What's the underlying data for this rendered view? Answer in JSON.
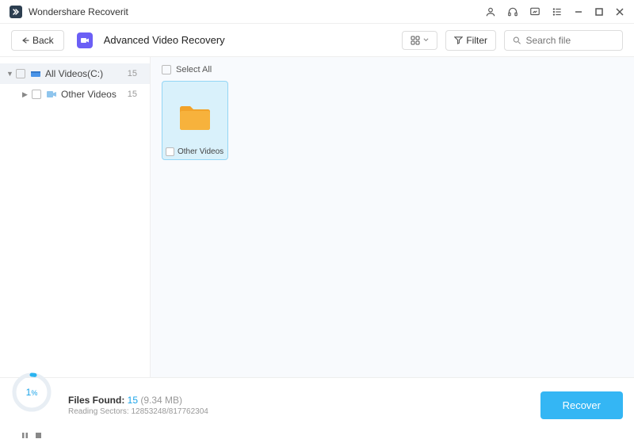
{
  "app": {
    "title": "Wondershare Recoverit"
  },
  "toolbar": {
    "back_label": "Back",
    "page_title": "Advanced Video Recovery",
    "filter_label": "Filter",
    "search_placeholder": "Search file"
  },
  "sidebar": {
    "items": [
      {
        "label": "All Videos(C:)",
        "count": "15"
      },
      {
        "label": "Other Videos",
        "count": "15"
      }
    ]
  },
  "content": {
    "select_all_label": "Select All",
    "files": [
      {
        "label": "Other Videos"
      }
    ]
  },
  "footer": {
    "progress_pct": "1",
    "files_found_label": "Files Found: ",
    "files_found_count": "15",
    "files_found_size": "(9.34 MB)",
    "reading_label": "Reading Sectors: ",
    "reading_value": "12853248/817762304",
    "recover_label": "Recover"
  }
}
